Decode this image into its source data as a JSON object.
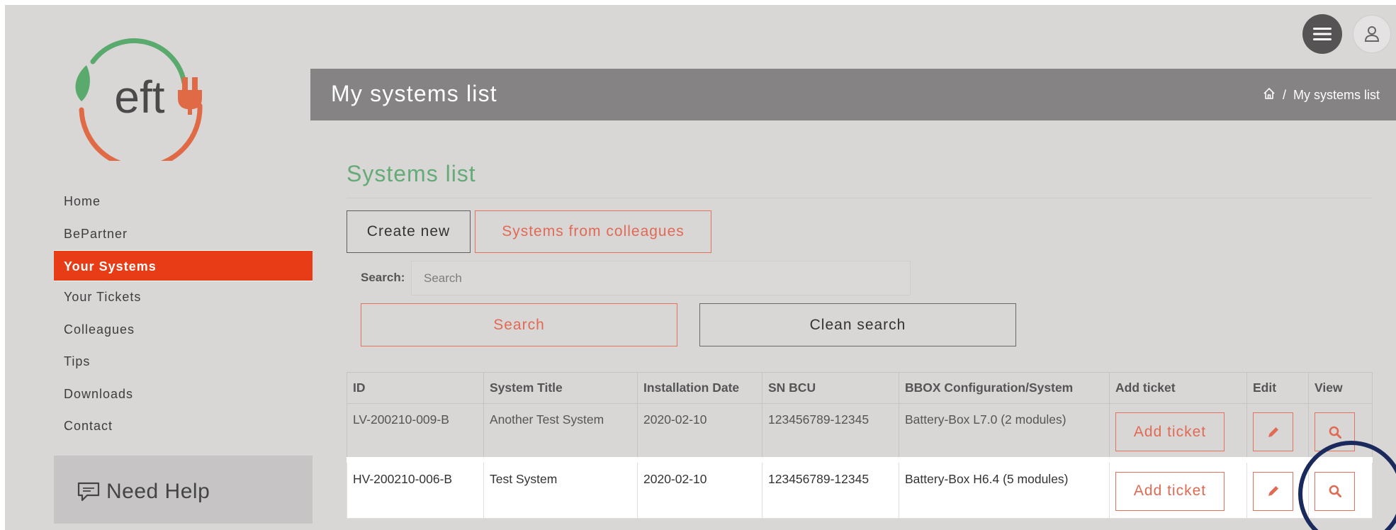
{
  "brand": {
    "logo_text": "eft",
    "colors": {
      "green": "#5aa96d",
      "orange": "#e06a46",
      "active": "#e73c16"
    }
  },
  "topbar": {
    "menu_icon": "hamburger-icon",
    "user_icon": "user-icon"
  },
  "sidebar": {
    "items": [
      {
        "label": "Home",
        "active": false
      },
      {
        "label": "BePartner",
        "active": false
      },
      {
        "label": "Your Systems",
        "active": true
      },
      {
        "label": "Your Tickets",
        "active": false
      },
      {
        "label": "Colleagues",
        "active": false
      },
      {
        "label": "Tips",
        "active": false
      },
      {
        "label": "Downloads",
        "active": false
      },
      {
        "label": "Contact",
        "active": false
      }
    ],
    "help": {
      "label": "Need Help",
      "icon": "chat-bubble-icon"
    }
  },
  "header": {
    "title": "My systems list",
    "breadcrumb": {
      "home_icon": "home-icon",
      "separator": "/",
      "current": "My systems list"
    }
  },
  "main": {
    "section_title": "Systems list",
    "buttons": {
      "create": "Create new",
      "colleagues": "Systems from colleagues"
    },
    "search": {
      "label": "Search:",
      "placeholder": "Search",
      "value": "",
      "search_button": "Search",
      "clean_button": "Clean search"
    },
    "table": {
      "columns": [
        "ID",
        "System Title",
        "Installation Date",
        "SN BCU",
        "BBOX Configuration/System",
        "Add ticket",
        "Edit",
        "View"
      ],
      "rows": [
        {
          "id": "LV-200210-009-B",
          "title": "Another Test System",
          "date": "2020-02-10",
          "sn": "123456789-12345",
          "config": "Battery-Box L7.0 (2 modules)",
          "add_ticket": "Add ticket",
          "edit_icon": "pencil-icon",
          "view_icon": "magnifier-icon"
        },
        {
          "id": "HV-200210-006-B",
          "title": "Test System",
          "date": "2020-02-10",
          "sn": "123456789-12345",
          "config": "Battery-Box H6.4 (5 modules)",
          "add_ticket": "Add ticket",
          "edit_icon": "pencil-icon",
          "view_icon": "magnifier-icon"
        }
      ]
    }
  }
}
